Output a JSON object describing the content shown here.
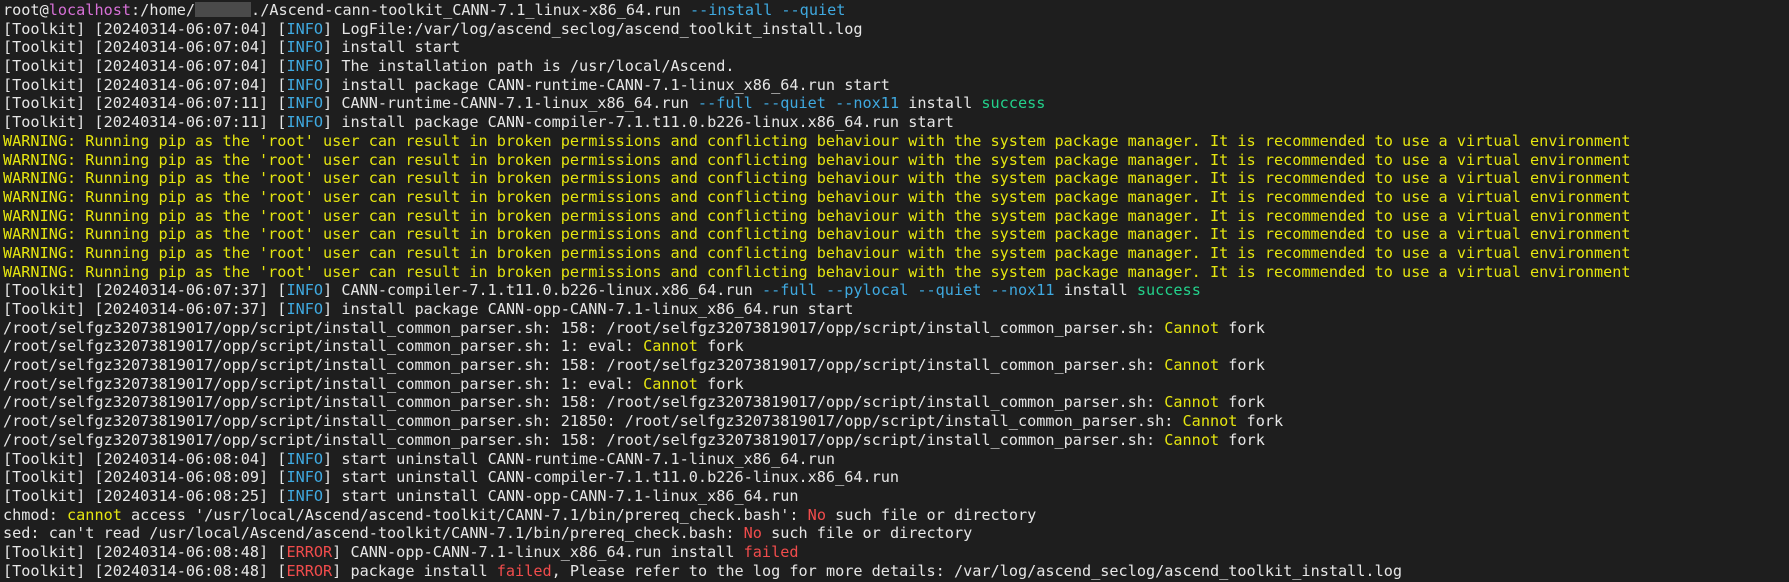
{
  "colors": {
    "background": "#1e1e1e",
    "default": "#e6e6e6",
    "host": "#d670d6",
    "cyan": "#3fa9e0",
    "green": "#23d18b",
    "yellow": "#e5e510",
    "red": "#f14c4c"
  },
  "terminal": {
    "lines": [
      {
        "segments": [
          {
            "text": "root",
            "color": "default"
          },
          {
            "text": "@",
            "color": "default"
          },
          {
            "text": "localhost",
            "color": "host"
          },
          {
            "text": ":/home/",
            "color": "default"
          },
          {
            "redacted": true
          },
          {
            "text": "./Ascend-cann-toolkit_CANN-7.1_linux-x86_64.run ",
            "color": "default"
          },
          {
            "text": "--install --quiet",
            "color": "cyan"
          }
        ]
      },
      {
        "segments": [
          {
            "text": "[Toolkit] [20240314-06:07:04] [",
            "color": "default"
          },
          {
            "text": "INFO",
            "color": "cyan"
          },
          {
            "text": "] LogFile:/var/log/ascend_seclog/ascend_toolkit_install.log",
            "color": "default"
          }
        ]
      },
      {
        "segments": [
          {
            "text": "[Toolkit] [20240314-06:07:04] [",
            "color": "default"
          },
          {
            "text": "INFO",
            "color": "cyan"
          },
          {
            "text": "] install start",
            "color": "default"
          }
        ]
      },
      {
        "segments": [
          {
            "text": "[Toolkit] [20240314-06:07:04] [",
            "color": "default"
          },
          {
            "text": "INFO",
            "color": "cyan"
          },
          {
            "text": "] The installation path is /usr/local/Ascend.",
            "color": "default"
          }
        ]
      },
      {
        "segments": [
          {
            "text": "[Toolkit] [20240314-06:07:04] [",
            "color": "default"
          },
          {
            "text": "INFO",
            "color": "cyan"
          },
          {
            "text": "] install package CANN-runtime-CANN-7.1-linux_x86_64.run start",
            "color": "default"
          }
        ]
      },
      {
        "segments": [
          {
            "text": "[Toolkit] [20240314-06:07:11] [",
            "color": "default"
          },
          {
            "text": "INFO",
            "color": "cyan"
          },
          {
            "text": "] CANN-runtime-CANN-7.1-linux_x86_64.run ",
            "color": "default"
          },
          {
            "text": "--full --quiet --nox11",
            "color": "cyan"
          },
          {
            "text": " install ",
            "color": "default"
          },
          {
            "text": "success",
            "color": "green"
          }
        ]
      },
      {
        "segments": [
          {
            "text": "[Toolkit] [20240314-06:07:11] [",
            "color": "default"
          },
          {
            "text": "INFO",
            "color": "cyan"
          },
          {
            "text": "] install package CANN-compiler-7.1.t11.0.b226-linux.x86_64.run start",
            "color": "default"
          }
        ]
      },
      {
        "segments": [
          {
            "text": "WARNING: Running pip as the 'root' user can result in broken permissions and conflicting behaviour with the system package manager. It is recommended to use a virtual environment",
            "color": "yellow"
          }
        ]
      },
      {
        "segments": [
          {
            "text": "WARNING: Running pip as the 'root' user can result in broken permissions and conflicting behaviour with the system package manager. It is recommended to use a virtual environment",
            "color": "yellow"
          }
        ]
      },
      {
        "segments": [
          {
            "text": "WARNING: Running pip as the 'root' user can result in broken permissions and conflicting behaviour with the system package manager. It is recommended to use a virtual environment",
            "color": "yellow"
          }
        ]
      },
      {
        "segments": [
          {
            "text": "WARNING: Running pip as the 'root' user can result in broken permissions and conflicting behaviour with the system package manager. It is recommended to use a virtual environment",
            "color": "yellow"
          }
        ]
      },
      {
        "segments": [
          {
            "text": "WARNING: Running pip as the 'root' user can result in broken permissions and conflicting behaviour with the system package manager. It is recommended to use a virtual environment",
            "color": "yellow"
          }
        ]
      },
      {
        "segments": [
          {
            "text": "WARNING: Running pip as the 'root' user can result in broken permissions and conflicting behaviour with the system package manager. It is recommended to use a virtual environment",
            "color": "yellow"
          }
        ]
      },
      {
        "segments": [
          {
            "text": "WARNING: Running pip as the 'root' user can result in broken permissions and conflicting behaviour with the system package manager. It is recommended to use a virtual environment",
            "color": "yellow"
          }
        ]
      },
      {
        "segments": [
          {
            "text": "WARNING: Running pip as the 'root' user can result in broken permissions and conflicting behaviour with the system package manager. It is recommended to use a virtual environment",
            "color": "yellow"
          }
        ]
      },
      {
        "segments": [
          {
            "text": "[Toolkit] [20240314-06:07:37] [",
            "color": "default"
          },
          {
            "text": "INFO",
            "color": "cyan"
          },
          {
            "text": "] CANN-compiler-7.1.t11.0.b226-linux.x86_64.run ",
            "color": "default"
          },
          {
            "text": "--full --pylocal --quiet --nox11",
            "color": "cyan"
          },
          {
            "text": " install ",
            "color": "default"
          },
          {
            "text": "success",
            "color": "green"
          }
        ]
      },
      {
        "segments": [
          {
            "text": "[Toolkit] [20240314-06:07:37] [",
            "color": "default"
          },
          {
            "text": "INFO",
            "color": "cyan"
          },
          {
            "text": "] install package CANN-opp-CANN-7.1-linux_x86_64.run start",
            "color": "default"
          }
        ]
      },
      {
        "segments": [
          {
            "text": "/root/selfgz32073819017/opp/script/install_common_parser.sh: 158: /root/selfgz32073819017/opp/script/install_common_parser.sh: ",
            "color": "default"
          },
          {
            "text": "Cannot",
            "color": "yellow"
          },
          {
            "text": " fork",
            "color": "default"
          }
        ]
      },
      {
        "segments": [
          {
            "text": "/root/selfgz32073819017/opp/script/install_common_parser.sh: 1: eval: ",
            "color": "default"
          },
          {
            "text": "Cannot",
            "color": "yellow"
          },
          {
            "text": " fork",
            "color": "default"
          }
        ]
      },
      {
        "segments": [
          {
            "text": "/root/selfgz32073819017/opp/script/install_common_parser.sh: 158: /root/selfgz32073819017/opp/script/install_common_parser.sh: ",
            "color": "default"
          },
          {
            "text": "Cannot",
            "color": "yellow"
          },
          {
            "text": " fork",
            "color": "default"
          }
        ]
      },
      {
        "segments": [
          {
            "text": "/root/selfgz32073819017/opp/script/install_common_parser.sh: 1: eval: ",
            "color": "default"
          },
          {
            "text": "Cannot",
            "color": "yellow"
          },
          {
            "text": " fork",
            "color": "default"
          }
        ]
      },
      {
        "segments": [
          {
            "text": "/root/selfgz32073819017/opp/script/install_common_parser.sh: 158: /root/selfgz32073819017/opp/script/install_common_parser.sh: ",
            "color": "default"
          },
          {
            "text": "Cannot",
            "color": "yellow"
          },
          {
            "text": " fork",
            "color": "default"
          }
        ]
      },
      {
        "segments": [
          {
            "text": "/root/selfgz32073819017/opp/script/install_common_parser.sh: 21850: /root/selfgz32073819017/opp/script/install_common_parser.sh: ",
            "color": "default"
          },
          {
            "text": "Cannot",
            "color": "yellow"
          },
          {
            "text": " fork",
            "color": "default"
          }
        ]
      },
      {
        "segments": [
          {
            "text": "/root/selfgz32073819017/opp/script/install_common_parser.sh: 158: /root/selfgz32073819017/opp/script/install_common_parser.sh: ",
            "color": "default"
          },
          {
            "text": "Cannot",
            "color": "yellow"
          },
          {
            "text": " fork",
            "color": "default"
          }
        ]
      },
      {
        "segments": [
          {
            "text": "[Toolkit] [20240314-06:08:04] [",
            "color": "default"
          },
          {
            "text": "INFO",
            "color": "cyan"
          },
          {
            "text": "] start uninstall CANN-runtime-CANN-7.1-linux_x86_64.run",
            "color": "default"
          }
        ]
      },
      {
        "segments": [
          {
            "text": "[Toolkit] [20240314-06:08:09] [",
            "color": "default"
          },
          {
            "text": "INFO",
            "color": "cyan"
          },
          {
            "text": "] start uninstall CANN-compiler-7.1.t11.0.b226-linux.x86_64.run",
            "color": "default"
          }
        ]
      },
      {
        "segments": [
          {
            "text": "[Toolkit] [20240314-06:08:25] [",
            "color": "default"
          },
          {
            "text": "INFO",
            "color": "cyan"
          },
          {
            "text": "] start uninstall CANN-opp-CANN-7.1-linux_x86_64.run",
            "color": "default"
          }
        ]
      },
      {
        "segments": [
          {
            "text": "chmod: ",
            "color": "default"
          },
          {
            "text": "cannot",
            "color": "yellow"
          },
          {
            "text": " access '/usr/local/Ascend/ascend-toolkit/CANN-7.1/bin/prereq_check.bash': ",
            "color": "default"
          },
          {
            "text": "No",
            "color": "red"
          },
          {
            "text": " such file or directory",
            "color": "default"
          }
        ]
      },
      {
        "segments": [
          {
            "text": "sed: can't read /usr/local/Ascend/ascend-toolkit/CANN-7.1/bin/prereq_check.bash: ",
            "color": "default"
          },
          {
            "text": "No",
            "color": "red"
          },
          {
            "text": " such file or directory",
            "color": "default"
          }
        ]
      },
      {
        "segments": [
          {
            "text": "[Toolkit] [20240314-06:08:48] [",
            "color": "default"
          },
          {
            "text": "ERROR",
            "color": "red"
          },
          {
            "text": "] CANN-opp-CANN-7.1-linux_x86_64.run install ",
            "color": "default"
          },
          {
            "text": "failed",
            "color": "red"
          }
        ]
      },
      {
        "segments": [
          {
            "text": "[Toolkit] [20240314-06:08:48] [",
            "color": "default"
          },
          {
            "text": "ERROR",
            "color": "red"
          },
          {
            "text": "] package install ",
            "color": "default"
          },
          {
            "text": "failed",
            "color": "red"
          },
          {
            "text": ", Please refer to the log for more details: /var/log/ascend_seclog/ascend_toolkit_install.log",
            "color": "default"
          }
        ]
      }
    ]
  }
}
